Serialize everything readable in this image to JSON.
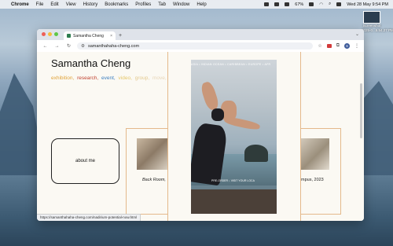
{
  "menubar": {
    "app": "Chrome",
    "items": [
      "File",
      "Edit",
      "View",
      "History",
      "Bookmarks",
      "Profiles",
      "Tab",
      "Window",
      "Help"
    ],
    "battery": "67%",
    "datetime": "Wed 28 May 9:54 PM"
  },
  "desktop_icon": {
    "label_line1": "Screenshot",
    "label_line2": "2025-0...5.54.27 PM"
  },
  "browser": {
    "tab_title": "Samantha Cheng",
    "new_tab": "+",
    "url": "samanthahaha-cheng.com",
    "profile_initial": "S",
    "status_url": "https://samanthahaha-cheng.com/nadirium-potential-now.html"
  },
  "page": {
    "title": "Samantha Cheng",
    "nav": [
      {
        "label": "exhibition,",
        "color": "#e0a33a"
      },
      {
        "label": "research,",
        "color": "#c24532"
      },
      {
        "label": "event,",
        "color": "#3d7fc0"
      },
      {
        "label": "video,",
        "color": "#e6c76a"
      },
      {
        "label": "group,",
        "color": "#e3c98f"
      },
      {
        "label": "move,",
        "color": "#e8d6b8"
      },
      {
        "label": "…",
        "color": "#ecdcc4"
      }
    ],
    "about_label": "about me",
    "left_card_caption": "Back Room,",
    "right_card_caption": "mpus, 2023",
    "overlay_marquee": "ASIA • INDIAN OCEAN • CARIBBEAN • EUROPE • AFR",
    "overlay_caption": "PRE-ORDER ↓ VISIT YOUR LOCA"
  }
}
